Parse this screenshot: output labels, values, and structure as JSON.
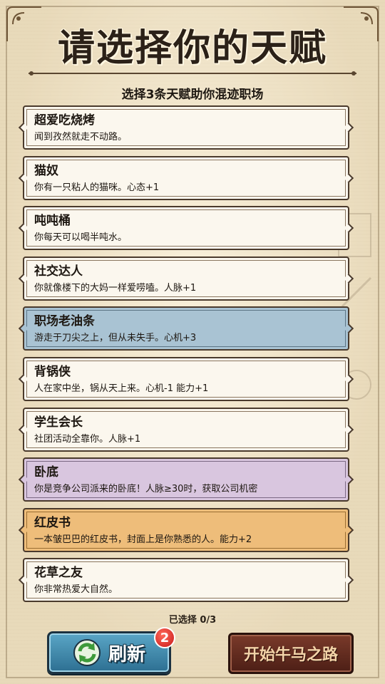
{
  "header": {
    "title": "请选择你的天赋",
    "subtitle": "选择3条天赋助你混迹职场"
  },
  "talents": [
    {
      "title": "超爱吃烧烤",
      "desc": "闻到孜然就走不动路。",
      "color": "#fbf7ee"
    },
    {
      "title": "猫奴",
      "desc": "你有一只粘人的猫咪。心态+1",
      "color": "#fbf7ee"
    },
    {
      "title": "吨吨桶",
      "desc": "你每天可以喝半吨水。",
      "color": "#fbf7ee"
    },
    {
      "title": "社交达人",
      "desc": "你就像楼下的大妈一样爱唠嗑。人脉+1",
      "color": "#fbf7ee"
    },
    {
      "title": "职场老油条",
      "desc": "游走于刀尖之上，但从未失手。心机+3",
      "color": "#a9c3d3"
    },
    {
      "title": "背锅侠",
      "desc": "人在家中坐，锅从天上来。心机-1 能力+1",
      "color": "#fbf7ee"
    },
    {
      "title": "学生会长",
      "desc": "社团活动全靠你。人脉+1",
      "color": "#fbf7ee"
    },
    {
      "title": "卧底",
      "desc": "你是竞争公司派来的卧底！人脉≥30时，获取公司机密",
      "color": "#d9c6df"
    },
    {
      "title": "红皮书",
      "desc": "一本皱巴巴的红皮书，封面上是你熟悉的人。能力+2",
      "color": "#eebd7a"
    },
    {
      "title": "花草之友",
      "desc": "你非常热爱大自然。",
      "color": "#fbf7ee"
    }
  ],
  "status": {
    "selected": "已选择 0/3"
  },
  "buttons": {
    "refresh_label": "刷新",
    "refresh_icon": "refresh-icon",
    "refresh_count": "2",
    "start_label": "开始牛马之路"
  }
}
